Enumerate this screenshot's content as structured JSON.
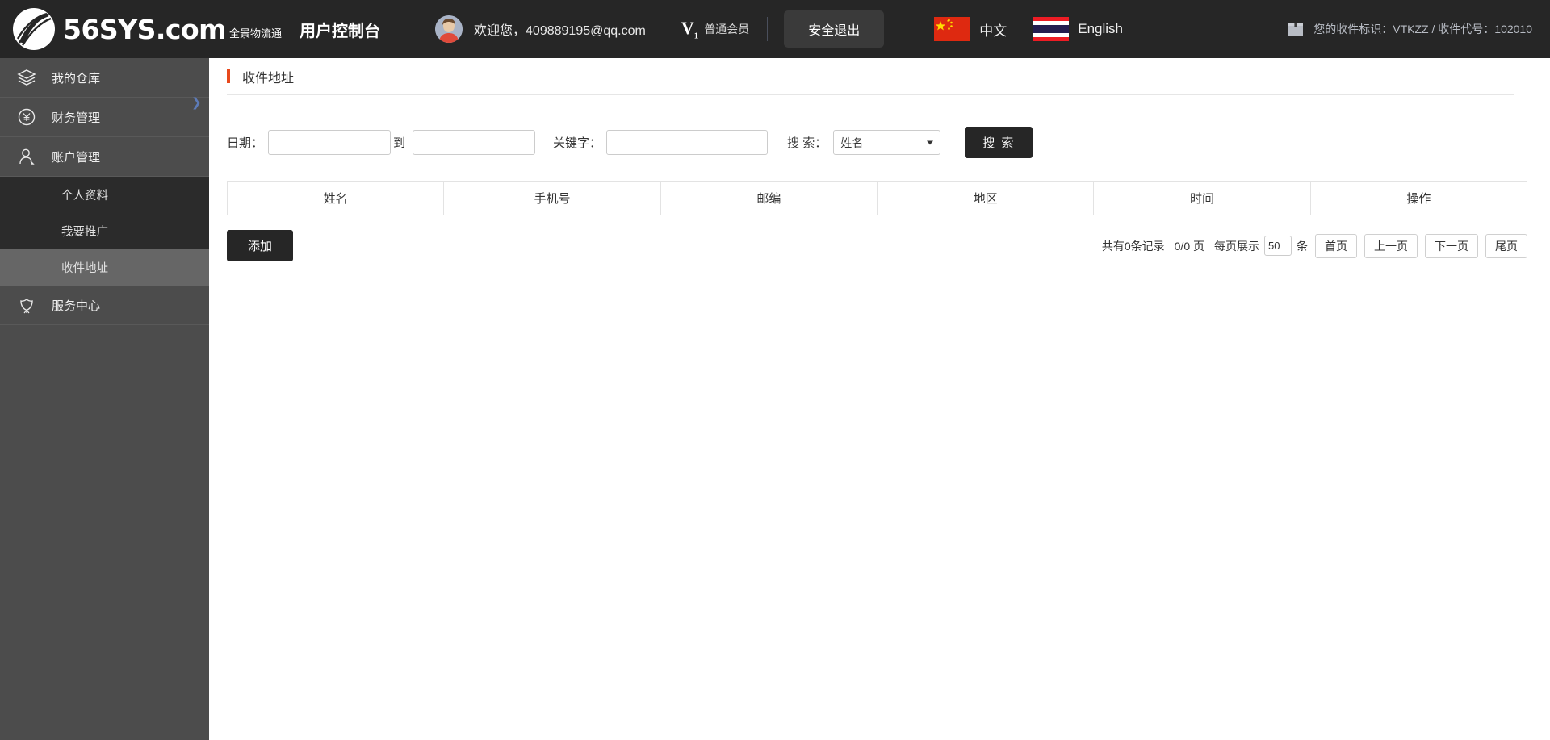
{
  "topbar": {
    "logo_name": "56SYS",
    "logo_domain": ".com",
    "logo_slogan": "全景物流通",
    "console_title": "用户控制台",
    "welcome_text": "欢迎您，409889195@qq.com",
    "vip_level": "V",
    "vip_level_sub": "1",
    "vip_label": "普通会员",
    "logout_label": "安全退出",
    "lang_cn": "中文",
    "lang_en": "English",
    "recv_info": "您的收件标识：VTKZZ / 收件代号：102010",
    "accent_color": "#e8491d",
    "bar_color": "#262626"
  },
  "sidebar": {
    "items": [
      {
        "label": "我的仓库",
        "icon": "layers-icon"
      },
      {
        "label": "财务管理",
        "icon": "yen-circle-icon"
      },
      {
        "label": "账户管理",
        "icon": "user-icon"
      }
    ],
    "subitems": [
      {
        "label": "个人资料",
        "active": false
      },
      {
        "label": "我要推广",
        "active": false
      },
      {
        "label": "收件地址",
        "active": true
      }
    ],
    "service": {
      "label": "服务中心",
      "icon": "lotus-icon"
    }
  },
  "main": {
    "page_title": "收件地址",
    "search": {
      "date_label": "日期：",
      "date_from_value": "",
      "date_from_placeholder": "",
      "to_label": "到",
      "date_to_value": "",
      "date_to_placeholder": "",
      "keyword_label": "关键字：",
      "keyword_value": "",
      "keyword_placeholder": "",
      "search_by_label": "搜 索：",
      "search_by_value": "姓名",
      "search_button": "搜 索"
    },
    "table": {
      "headers": [
        "姓名",
        "手机号",
        "邮编",
        "地区",
        "时间",
        "操作"
      ],
      "rows": []
    },
    "add_button": "添加",
    "pager": {
      "total_text": "共有0条记录",
      "page_text": "0/0 页",
      "per_page_label": "每页展示",
      "per_page_value": "50",
      "unit_text": "条",
      "first_label": "首页",
      "prev_label": "上一页",
      "next_label": "下一页",
      "last_label": "尾页"
    }
  }
}
